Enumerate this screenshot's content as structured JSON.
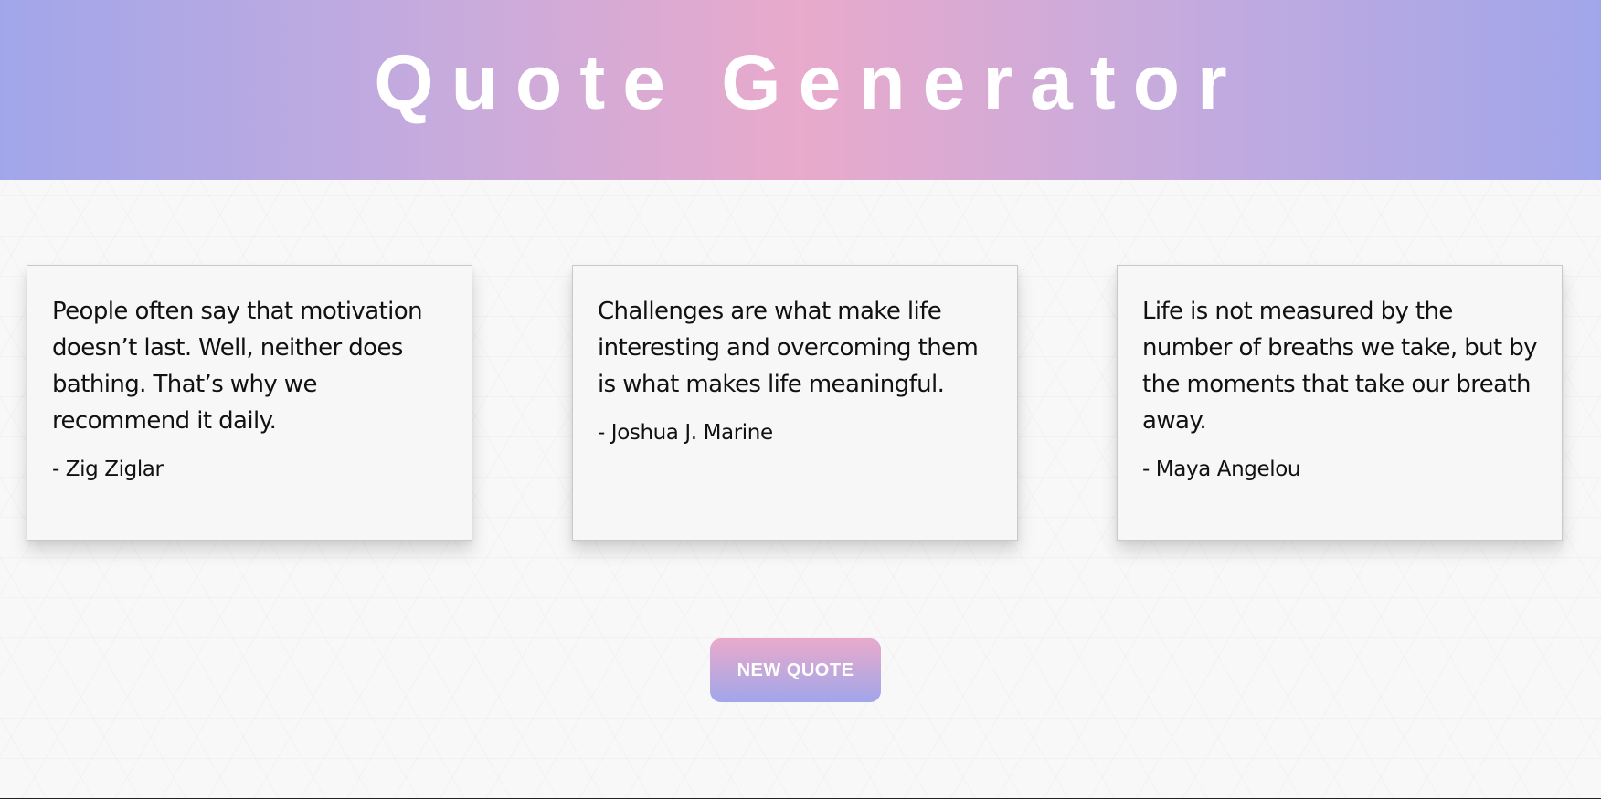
{
  "header": {
    "title": "Quote Generator"
  },
  "quotes": [
    {
      "text": "People often say that motivation doesn’t last. Well, neither does bathing. That’s why we recommend it daily.",
      "author": "- Zig Ziglar"
    },
    {
      "text": "Challenges are what make life interesting and overcoming them is what makes life meaningful.",
      "author": "- Joshua J. Marine"
    },
    {
      "text": "Life is not measured by the number of breaths we take, but by the moments that take our breath away.",
      "author": "- Maya Angelou"
    }
  ],
  "actions": {
    "new_quote_label": "NEW QUOTE"
  },
  "colors": {
    "gradient_edge": "#a1a6ea",
    "gradient_center": "#e9aacb",
    "background": "#f8f8f8",
    "text": "#111111"
  }
}
